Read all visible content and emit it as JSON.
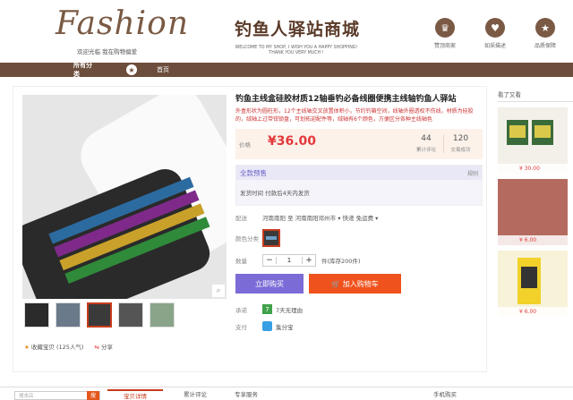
{
  "header": {
    "logo": "Fashion",
    "welcome": "欢迎光临  我在购物偏爱",
    "shop_name": "钓鱼人驿站商城",
    "subtitle": "WELCOME TO MY SHOP, I WISH YOU A HAPPY SHOPPING! THANK YOU VERY MUCH !",
    "icons": [
      {
        "label": "赞顶商家",
        "glyph": "♛",
        "icon": "crown-icon"
      },
      {
        "label": "如采描述",
        "glyph": "♥",
        "icon": "heart-icon"
      },
      {
        "label": "品质保障",
        "glyph": "★",
        "icon": "star-icon"
      }
    ]
  },
  "nav": {
    "all": "所有分类",
    "home": "首页"
  },
  "product": {
    "title": "钓鱼主线盒硅胶材质12轴垂钓必备线圈便携主线轴钓鱼人驿站",
    "desc": "外盒形状为圆柱形，12个主线轴交叉放置体积小，节约钓箱空间，线轴外圈透权不伤线，材质为硅胶的，绒轴上过带钳锁盘，可划拓迎配件等，绒轴有6个颜色，方便区分各种主线轴色",
    "price_label": "价格",
    "price": "¥36.00",
    "stats": [
      {
        "n": "44",
        "t": "累计评论"
      },
      {
        "n": "120",
        "t": "交易成功"
      }
    ],
    "presale_title": "全款预售",
    "presale_rule": "规则",
    "ship_time": "发货时间  付款后4天内发货",
    "delivery_label": "配送",
    "delivery_value": "河南南阳 至  河南南阳邓州市 ▾   快递 免运费 ▾",
    "color_label": "颜色分类",
    "qty_label": "数量",
    "qty_value": "1",
    "stock": "件(库存200件)",
    "buy": "立即购买",
    "cart": "加入购物车",
    "promise_label": "承诺",
    "promise_value": "7天无理由",
    "pay_label": "支付",
    "pay_value": "集分宝",
    "collect": "收藏宝贝 (125人气)",
    "share": "分享"
  },
  "side": {
    "title": "看了又看",
    "items": [
      {
        "price": "¥ 30.00"
      },
      {
        "price": "¥ 6.00"
      },
      {
        "price": "¥ 6.00"
      }
    ]
  },
  "bottom": {
    "search_placeholder": "搜本店",
    "search_btn": "搜",
    "tabs": [
      "宝贝详情",
      "累计评论",
      "专享服务",
      "手机购买"
    ]
  }
}
